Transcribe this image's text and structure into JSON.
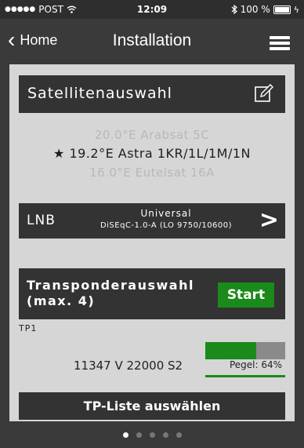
{
  "status_bar": {
    "signal_dots": "●●●●●",
    "carrier": "POST",
    "wifi_icon": "wifi-icon",
    "time": "12:09",
    "bluetooth_icon": "bluetooth-icon",
    "battery": "100 %"
  },
  "nav": {
    "back_label": "Home",
    "title": "Installation",
    "menu_icon": "hamburger-menu-icon"
  },
  "satellite": {
    "header": "Satellitenauswahl",
    "edit_icon": "edit-icon",
    "items": [
      {
        "label": "20.0°E Arabsat 5C",
        "selected": false
      },
      {
        "label": "★ 19.2°E Astra 1KR/1L/1M/1N",
        "selected": true
      },
      {
        "label": "16.0°E Eutelsat 16A",
        "selected": false
      }
    ]
  },
  "lnb": {
    "label": "LNB",
    "type": "Universal",
    "detail": "DiSEqC-1.0-A (LO 9750/10600)",
    "arrow_icon": "chevron-right-icon"
  },
  "transponder": {
    "header_line1": "Transponderauswahl",
    "header_line2": "(max. 4)",
    "start_label": "Start",
    "tp_label": "TP1",
    "tp_data": "11347 V 22000 S2",
    "level_text": "Pegel: 64%",
    "level_fraction": 0.64,
    "list_button": "TP-Liste auswählen"
  },
  "colors": {
    "accent_green": "#1a8a1a",
    "bar_dark": "#333333",
    "background": "#d6d6d6"
  },
  "pager": {
    "count": 5,
    "active_index": 0
  }
}
